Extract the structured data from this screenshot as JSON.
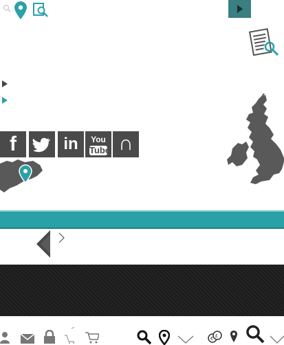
{
  "colors": {
    "accent_teal": "#2aa1a6",
    "dark_teal": "#3a7f82",
    "social_bg": "#4a4a4a",
    "map_grey": "#595959",
    "dark_band": "#1b1b1b"
  },
  "header": {
    "icons": [
      "search-small-icon",
      "map-pin-icon",
      "search-document-icon",
      "play-arrow-icon"
    ]
  },
  "social": {
    "facebook": "f",
    "twitter": "twitter-bird",
    "linkedin": "in",
    "youtube_you": "You",
    "youtube_tube": "Tube",
    "other": "∩"
  },
  "nav": {
    "arrow_left": "◀",
    "arrow_right": ">"
  },
  "footer": {
    "icons": [
      "person-icon",
      "envelope-icon",
      "padlock-icon",
      "cart-icon",
      "cart-icon",
      "search-icon",
      "map-pin-icon",
      "chevron-down-icon",
      "currency-icon",
      "map-pin-icon",
      "search-icon",
      "chevron-down-icon"
    ]
  }
}
